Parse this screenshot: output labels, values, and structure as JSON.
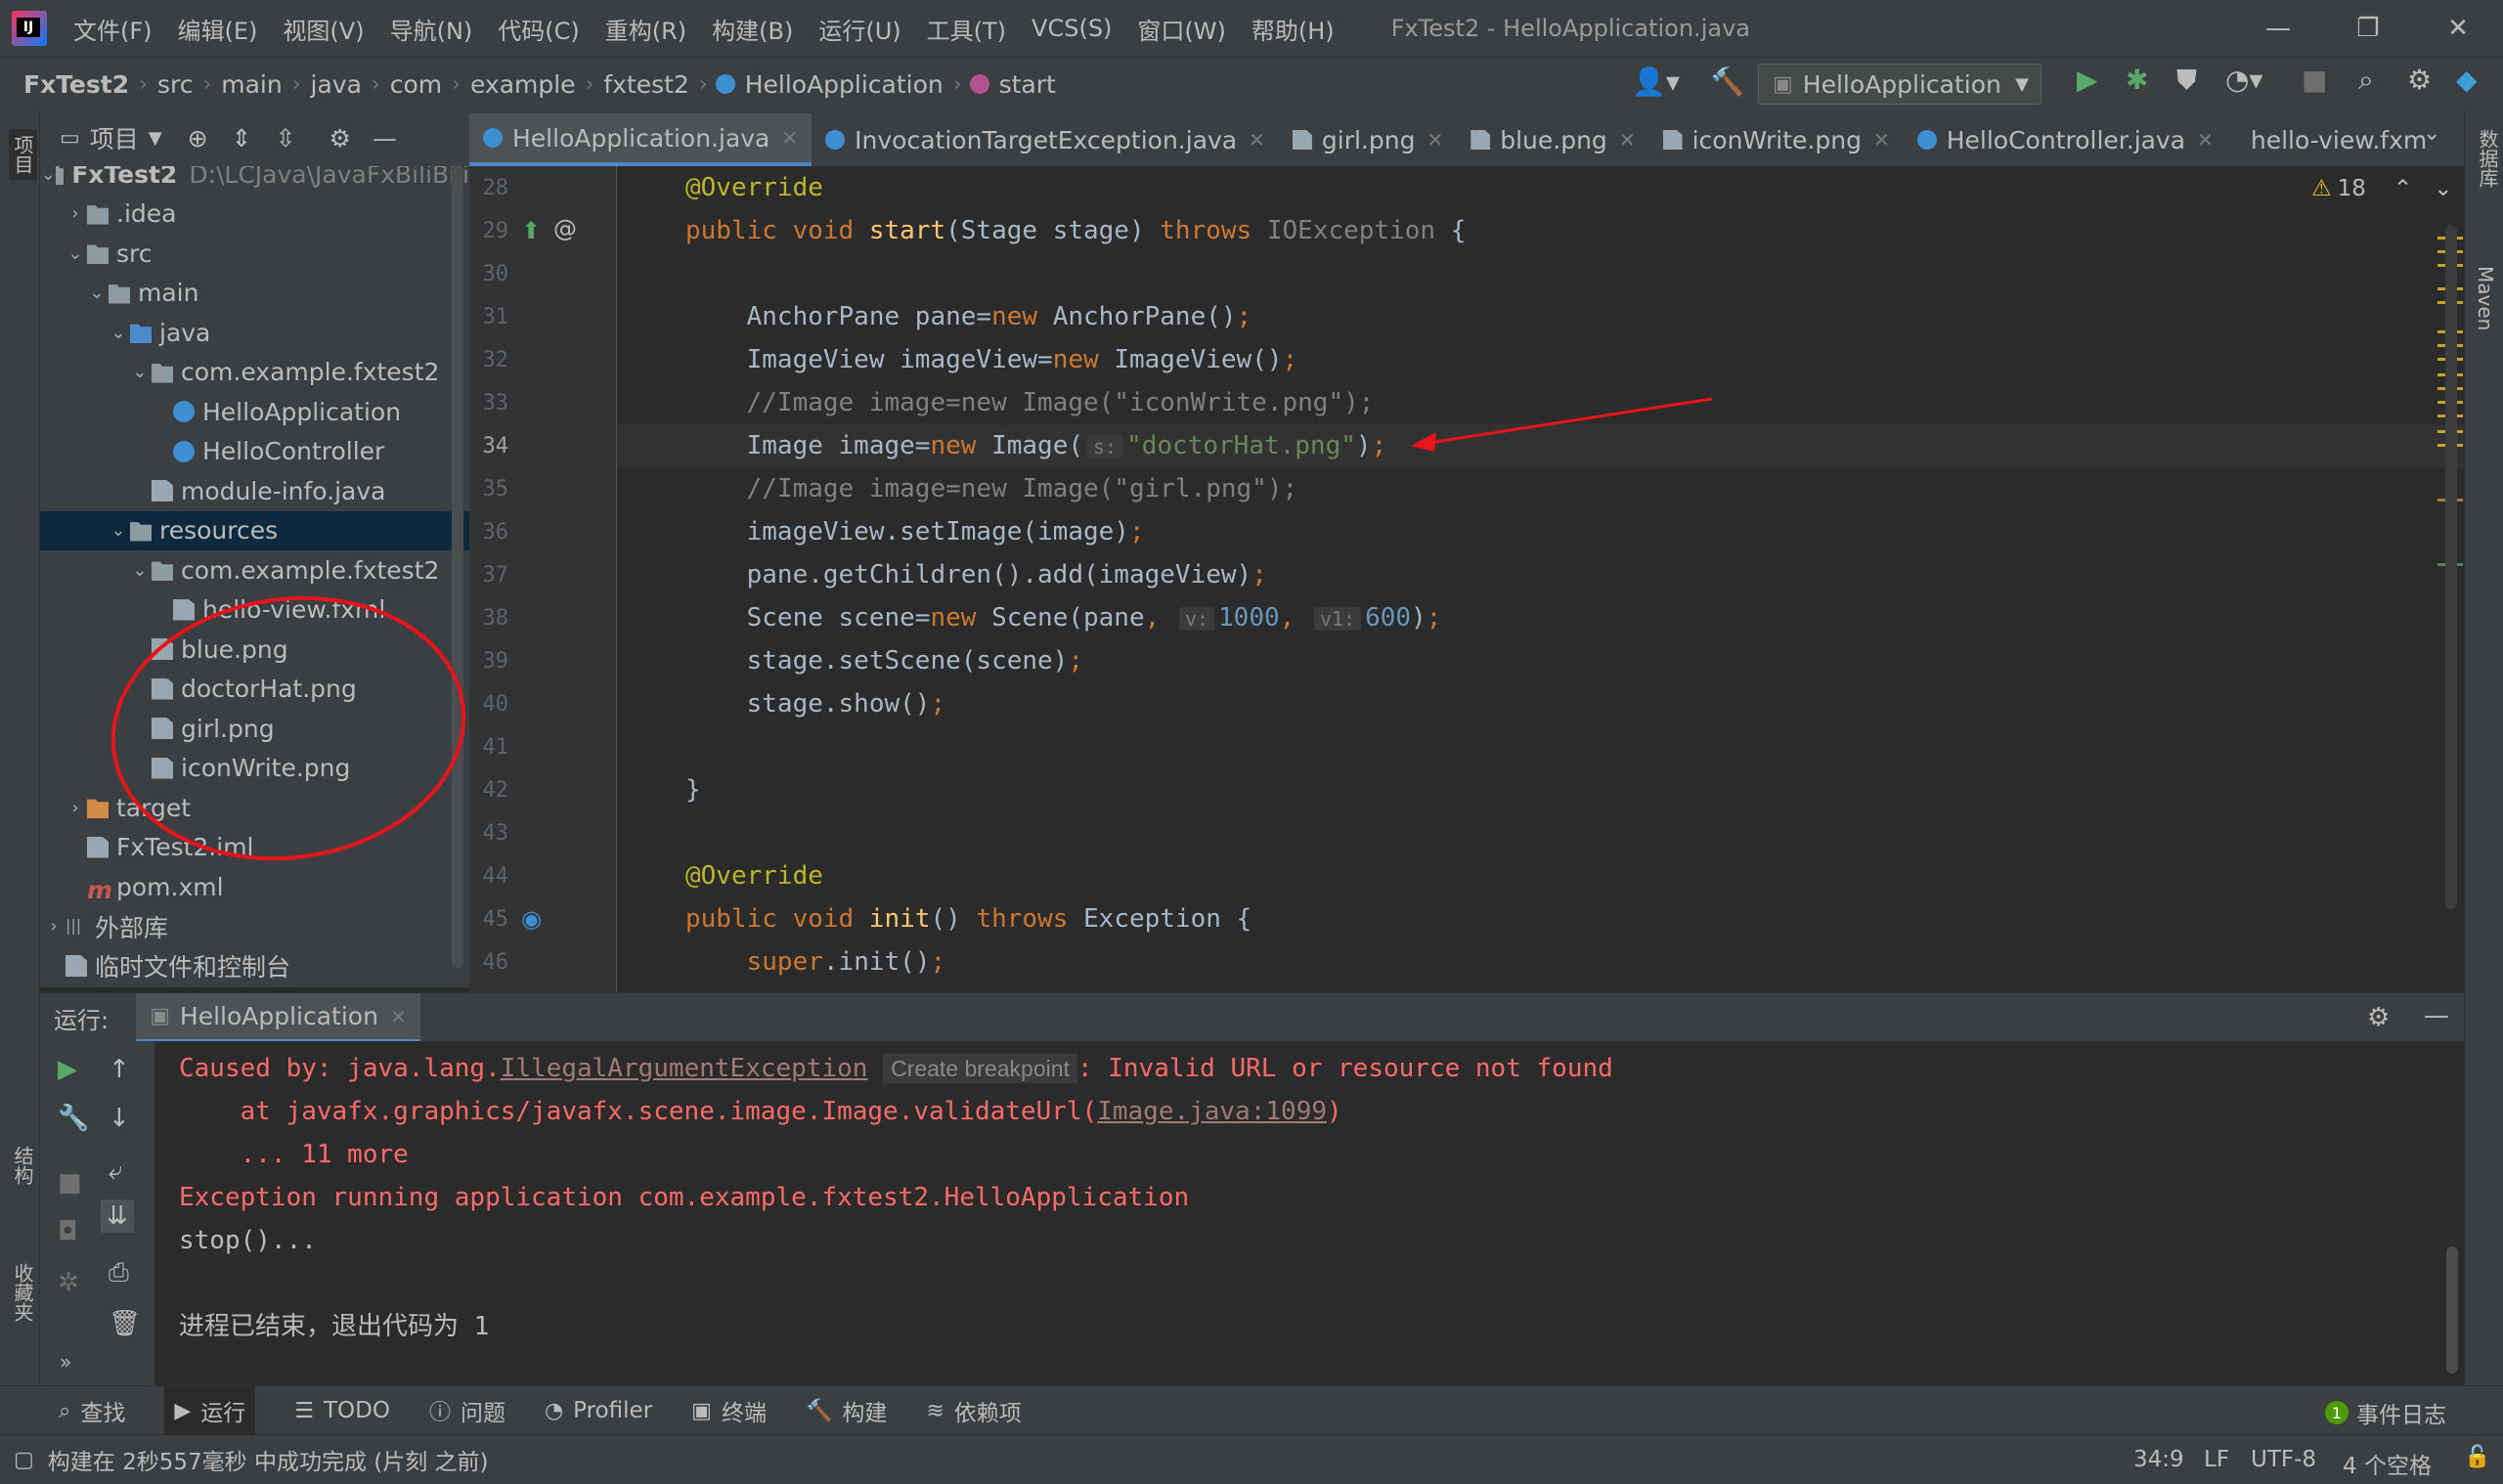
{
  "titlebar": {
    "menu": [
      "文件(F)",
      "编辑(E)",
      "视图(V)",
      "导航(N)",
      "代码(C)",
      "重构(R)",
      "构建(B)",
      "运行(U)",
      "工具(T)",
      "VCS(S)",
      "窗口(W)",
      "帮助(H)"
    ],
    "window_title": "FxTest2 - HelloApplication.java"
  },
  "breadcrumb": [
    "FxTest2",
    "src",
    "main",
    "java",
    "com",
    "example",
    "fxtest2",
    "HelloApplication",
    "start"
  ],
  "run_config": "HelloApplication",
  "project_panel": {
    "title": "项目",
    "left_strip_label": "项目",
    "tree": [
      {
        "indent": 0,
        "arrow": "⌄",
        "icon": "folder",
        "label": "FxTest2",
        "bold": true,
        "extra": "D:\\LCJava\\JavaFxBiliBili"
      },
      {
        "indent": 1,
        "arrow": "›",
        "icon": "folder",
        "label": ".idea"
      },
      {
        "indent": 1,
        "arrow": "⌄",
        "icon": "folder",
        "label": "src"
      },
      {
        "indent": 2,
        "arrow": "⌄",
        "icon": "folder",
        "label": "main"
      },
      {
        "indent": 3,
        "arrow": "⌄",
        "icon": "folder-blue",
        "label": "java"
      },
      {
        "indent": 4,
        "arrow": "⌄",
        "icon": "folder",
        "label": "com.example.fxtest2"
      },
      {
        "indent": 5,
        "arrow": "",
        "icon": "class",
        "label": "HelloApplication"
      },
      {
        "indent": 5,
        "arrow": "",
        "icon": "class",
        "label": "HelloController"
      },
      {
        "indent": 4,
        "arrow": "",
        "icon": "file",
        "label": "module-info.java"
      },
      {
        "indent": 3,
        "arrow": "⌄",
        "icon": "folder",
        "label": "resources",
        "selected": true
      },
      {
        "indent": 4,
        "arrow": "⌄",
        "icon": "folder",
        "label": "com.example.fxtest2"
      },
      {
        "indent": 5,
        "arrow": "",
        "icon": "file",
        "label": "hello-view.fxml"
      },
      {
        "indent": 4,
        "arrow": "",
        "icon": "file",
        "label": "blue.png"
      },
      {
        "indent": 4,
        "arrow": "",
        "icon": "file",
        "label": "doctorHat.png"
      },
      {
        "indent": 4,
        "arrow": "",
        "icon": "file",
        "label": "girl.png"
      },
      {
        "indent": 4,
        "arrow": "",
        "icon": "file",
        "label": "iconWrite.png"
      },
      {
        "indent": 1,
        "arrow": "›",
        "icon": "folder-orange",
        "label": "target"
      },
      {
        "indent": 1,
        "arrow": "",
        "icon": "file",
        "label": "FxTest2.iml"
      },
      {
        "indent": 1,
        "arrow": "",
        "icon": "maven",
        "label": "pom.xml"
      },
      {
        "indent": 0,
        "arrow": "›",
        "icon": "library",
        "label": "外部库"
      },
      {
        "indent": 0,
        "arrow": "",
        "icon": "scratch",
        "label": "临时文件和控制台"
      }
    ]
  },
  "editor": {
    "tabs": [
      {
        "label": "HelloApplication.java",
        "active": true
      },
      {
        "label": "InvocationTargetException.java"
      },
      {
        "label": "girl.png"
      },
      {
        "label": "blue.png"
      },
      {
        "label": "iconWrite.png"
      },
      {
        "label": "HelloController.java"
      },
      {
        "label": "hello-view.fxml"
      }
    ],
    "warning_count": "18",
    "line_numbers": [
      "28",
      "29",
      "30",
      "31",
      "32",
      "33",
      "34",
      "35",
      "36",
      "37",
      "38",
      "39",
      "40",
      "41",
      "42",
      "43",
      "44",
      "45",
      "46"
    ],
    "param_hints": {
      "s": "s:",
      "v": "v:",
      "v1": "v1:"
    }
  },
  "run_panel": {
    "label": "运行:",
    "tab": "HelloApplication",
    "console": {
      "l1a": "Caused by: java.lang.",
      "l1b": "IllegalArgumentException",
      "l1c": "Create breakpoint",
      "l1d": ": Invalid URL or resource not found",
      "l2a": "    at javafx.graphics/javafx.scene.image.Image.validateUrl(",
      "l2b": "Image.java:1099",
      "l2c": ")",
      "l3": "    ... 11 more",
      "l4": "Exception running application com.example.fxtest2.HelloApplication",
      "l5": "stop()...",
      "l6": "进程已结束，退出代码为 1"
    }
  },
  "bottom_tools": [
    "查找",
    "运行",
    "TODO",
    "问题",
    "Profiler",
    "终端",
    "构建",
    "依赖项"
  ],
  "event_log": {
    "count": "1",
    "label": "事件日志"
  },
  "status": {
    "message": "构建在 2秒557毫秒 中成功完成 (片刻 之前)",
    "position": "34:9",
    "line_ending": "LF",
    "encoding": "UTF-8",
    "indent": "4 个空格"
  },
  "side_labels": {
    "structure": "结构",
    "favorites": "收藏夹",
    "database": "数据库",
    "maven": "Maven"
  }
}
